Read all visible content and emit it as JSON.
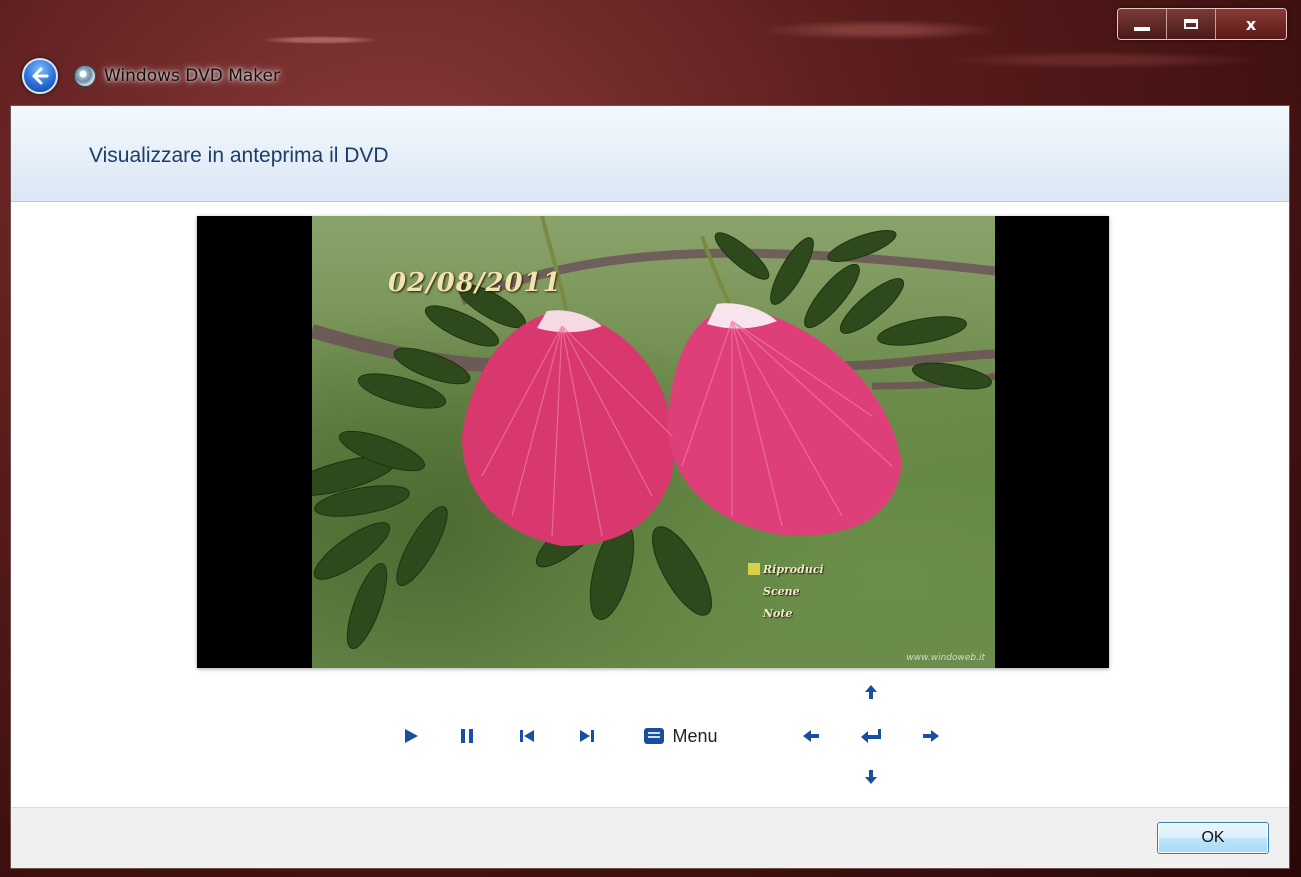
{
  "window": {
    "app_title": "Windows DVD Maker",
    "caption_buttons": [
      "minimize",
      "maximize",
      "close"
    ],
    "close_label": "x"
  },
  "header": {
    "title": "Visualizzare in anteprima il DVD"
  },
  "preview": {
    "date_overlay": "02/08/2011",
    "menu_items": [
      "Riproduci",
      "Scene",
      "Note"
    ],
    "selected_menu_item": "Riproduci",
    "watermark": "www.windoweb.it"
  },
  "controls": {
    "menu_label": "Menu",
    "icons": [
      "play-icon",
      "pause-icon",
      "previous-chapter-icon",
      "next-chapter-icon",
      "menu-icon",
      "arrow-up-icon",
      "arrow-left-icon",
      "enter-icon",
      "arrow-right-icon",
      "arrow-down-icon"
    ],
    "accent_color": "#1a4fa0"
  },
  "footer": {
    "ok_label": "OK"
  }
}
